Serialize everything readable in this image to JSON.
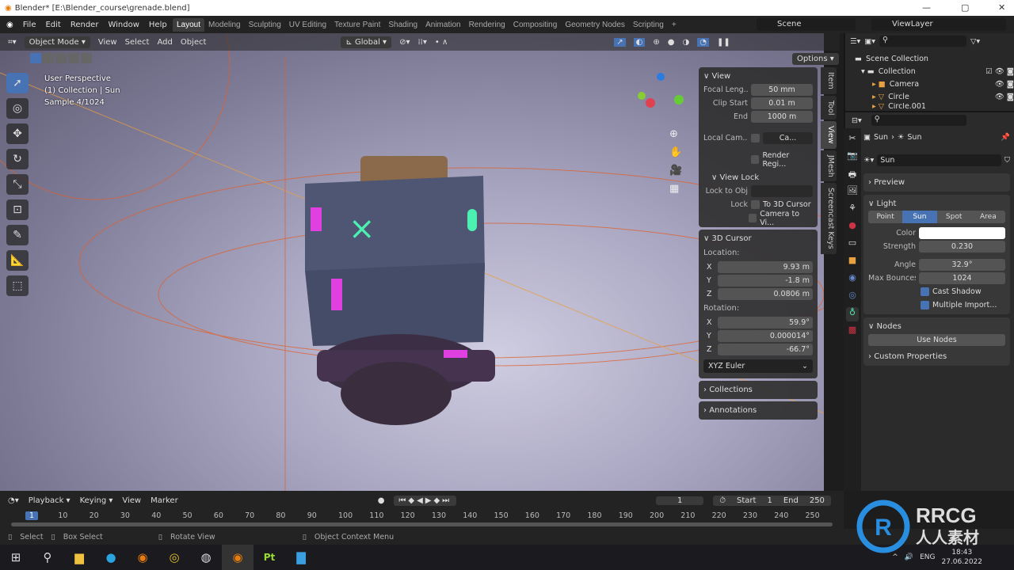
{
  "window": {
    "title": "Blender* [E:\\Blender_course\\grenade.blend]",
    "minimize": "—",
    "maximize": "▢",
    "close": "✕"
  },
  "menu": [
    "File",
    "Edit",
    "Render",
    "Window",
    "Help"
  ],
  "workspaces": [
    "Layout",
    "Modeling",
    "Sculpting",
    "UV Editing",
    "Texture Paint",
    "Shading",
    "Animation",
    "Rendering",
    "Compositing",
    "Geometry Nodes",
    "Scripting",
    "+"
  ],
  "scene": "Scene",
  "view_layer": "ViewLayer",
  "viewport_header": {
    "mode": "Object Mode",
    "menus": [
      "View",
      "Select",
      "Add",
      "Object"
    ],
    "orientation": "Global",
    "options": "Options"
  },
  "overlay": {
    "line1": "User Perspective",
    "line2": "(1) Collection | Sun",
    "line3": "Sample 4/1024"
  },
  "npanel": {
    "tabs": [
      "Item",
      "Tool",
      "View",
      "JMesh",
      "Screencast Keys"
    ],
    "view": {
      "title": "View",
      "focal_label": "Focal Leng...",
      "focal": "50 mm",
      "clip_start_label": "Clip Start",
      "clip_start": "0.01 m",
      "end_label": "End",
      "end": "1000 m",
      "local_cam_label": "Local Cam...",
      "local_cam": "Ca...",
      "render_region": "Render Regi..."
    },
    "view_lock": {
      "title": "View Lock",
      "lock_obj_label": "Lock to Obj",
      "lock_label": "Lock",
      "to_cursor": "To 3D Cursor",
      "camera_to_view": "Camera to Vi..."
    },
    "cursor": {
      "title": "3D Cursor",
      "location": "Location:",
      "lx": "9.93 m",
      "ly": "-1.8 m",
      "lz": "0.0806 m",
      "rotation": "Rotation:",
      "rx": "59.9°",
      "ry": "0.000014°",
      "rz": "-66.7°",
      "mode": "XYZ Euler",
      "x": "X",
      "y": "Y",
      "z": "Z"
    },
    "collections": "Collections",
    "annotations": "Annotations"
  },
  "outliner": {
    "scene_collection": "Scene Collection",
    "items": [
      "Collection",
      "Camera",
      "Circle",
      "Circle.001"
    ]
  },
  "properties": {
    "breadcrumb_obj": "Sun",
    "breadcrumb_data": "Sun",
    "datablock": "Sun",
    "preview": "Preview",
    "light": "Light",
    "types": [
      "Point",
      "Sun",
      "Spot",
      "Area"
    ],
    "active_type": "Sun",
    "color_label": "Color",
    "color": "#ffffff",
    "strength_label": "Strength",
    "strength": "0.230",
    "angle_label": "Angle",
    "angle": "32.9°",
    "bounces_label": "Max Bounces",
    "bounces": "1024",
    "cast_shadow": "Cast Shadow",
    "multiple_importance": "Multiple Import...",
    "nodes": "Nodes",
    "use_nodes": "Use Nodes",
    "custom_props": "Custom Properties"
  },
  "timeline": {
    "menus": [
      "Playback",
      "Keying",
      "View",
      "Marker"
    ],
    "current": "1",
    "start_label": "Start",
    "start": "1",
    "end_label": "End",
    "end": "250",
    "ticks": [
      "1",
      "10",
      "20",
      "30",
      "40",
      "50",
      "60",
      "70",
      "80",
      "90",
      "100",
      "110",
      "120",
      "130",
      "140",
      "150",
      "160",
      "170",
      "180",
      "190",
      "200",
      "210",
      "220",
      "230",
      "240",
      "250"
    ]
  },
  "status": {
    "select": "Select",
    "box_select": "Box Select",
    "rotate": "Rotate View",
    "context": "Object Context Menu"
  },
  "taskbar": {
    "lang": "ENG",
    "time": "18:43",
    "date": "27.06.2022"
  },
  "watermark": "RRCG 人人素材",
  "accent": "#4772b3"
}
